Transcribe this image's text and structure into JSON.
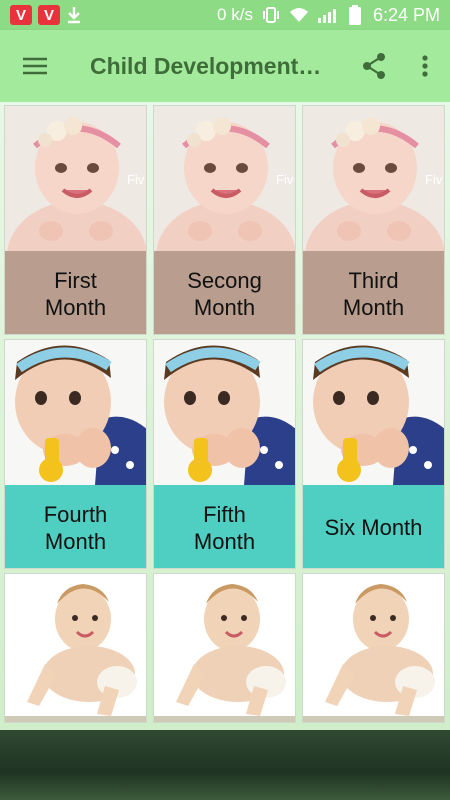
{
  "status_bar": {
    "net_speed": "0 k/s",
    "time": "6:24 PM",
    "app_icon_letter": "V"
  },
  "app_bar": {
    "title": "Child Development…"
  },
  "months": [
    {
      "label_line1": "First",
      "label_line2": "Month"
    },
    {
      "label_line1": "Secong",
      "label_line2": "Month"
    },
    {
      "label_line1": "Third",
      "label_line2": "Month"
    },
    {
      "label_line1": "Fourth",
      "label_line2": "Month"
    },
    {
      "label_line1": "Fifth",
      "label_line2": "Month"
    },
    {
      "label_line1": "Six Month",
      "label_line2": ""
    }
  ],
  "photo_watermark": "Fiv",
  "colors": {
    "app_bar_bg": "#a4ea9d",
    "title_color": "#3f6d3a",
    "label_brown": "#b99e8f",
    "label_teal": "#4fcfc2"
  }
}
